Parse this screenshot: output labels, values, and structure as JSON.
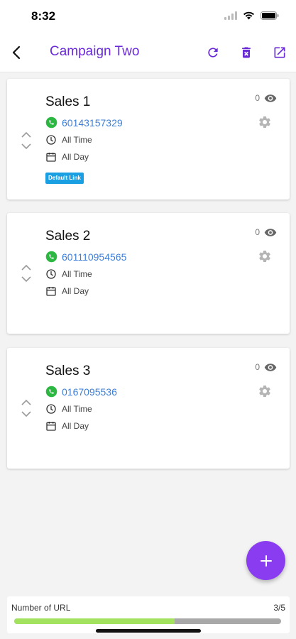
{
  "status_bar": {
    "time": "8:32",
    "icons": [
      "signal-icon",
      "wifi-icon",
      "battery-icon"
    ]
  },
  "header": {
    "title": "Campaign Two",
    "back_icon": "chevron-left-icon",
    "actions": [
      "refresh-icon",
      "delete-icon",
      "open-external-icon"
    ],
    "accent": "#6a2bd6"
  },
  "cards": [
    {
      "title": "Sales 1",
      "phone": "60143157329",
      "time": "All Time",
      "day": "All Day",
      "views": "0",
      "badge": "Default Link"
    },
    {
      "title": "Sales 2",
      "phone": "601110954565",
      "time": "All Time",
      "day": "All Day",
      "views": "0"
    },
    {
      "title": "Sales 3",
      "phone": "0167095536",
      "time": "All Time",
      "day": "All Day",
      "views": "0"
    }
  ],
  "fab": {
    "icon": "plus-icon",
    "color": "#8a3cf0"
  },
  "usage": {
    "label": "Number of URL",
    "count": "3/5",
    "fraction": 0.6,
    "fill_color": "#a3e25f"
  }
}
